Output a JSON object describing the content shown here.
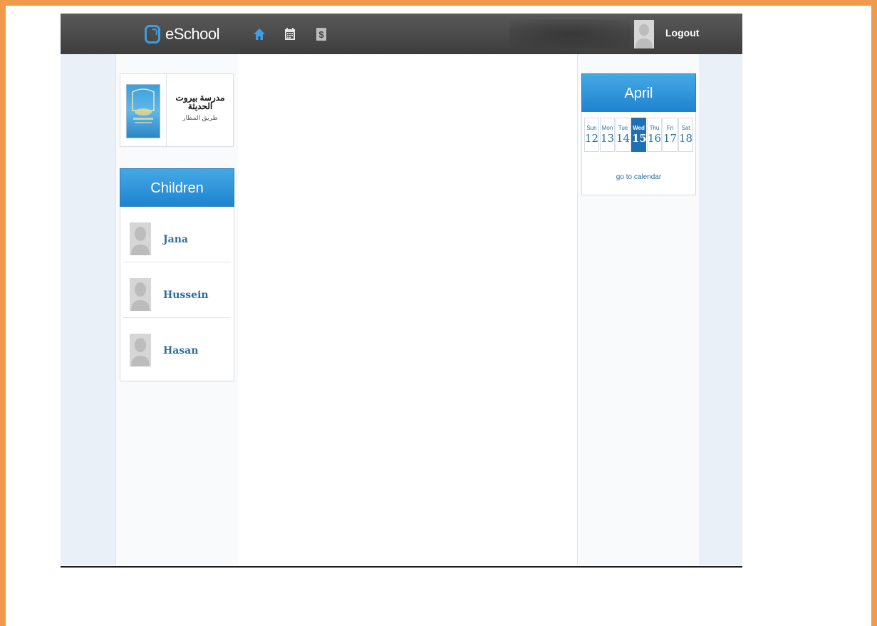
{
  "header": {
    "brand": "eSchool",
    "nav": [
      {
        "name": "home-icon"
      },
      {
        "name": "calendar-icon"
      },
      {
        "name": "dollar-icon"
      }
    ],
    "logout_label": "Logout"
  },
  "school": {
    "name": "مدرسة بيروت الحديثة",
    "address": "طريق المطار"
  },
  "children": {
    "title": "Children",
    "items": [
      {
        "name": "Jana"
      },
      {
        "name": "Hussein"
      },
      {
        "name": "Hasan"
      }
    ]
  },
  "calendar": {
    "month": "April",
    "days": [
      {
        "day": "Sun",
        "date": "12"
      },
      {
        "day": "Mon",
        "date": "13"
      },
      {
        "day": "Tue",
        "date": "14"
      },
      {
        "day": "Wed",
        "date": "15",
        "active": true
      },
      {
        "day": "Thu",
        "date": "16"
      },
      {
        "day": "Fri",
        "date": "17"
      },
      {
        "day": "Sat",
        "date": "18"
      }
    ],
    "link": "go to calendar"
  },
  "colors": {
    "accent": "#1f84cf",
    "frame": "#f29a4c",
    "topbar": "#474747",
    "link": "#2b6e9e"
  }
}
